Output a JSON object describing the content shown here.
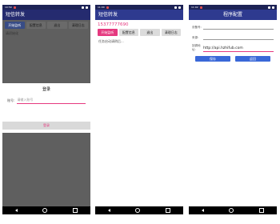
{
  "phone1": {
    "status": {
      "time": "10:59"
    },
    "app_title": "短信转发",
    "buttons": [
      "开始监听",
      "配置信息",
      "退出",
      "清理日志"
    ],
    "label": "请初始化",
    "dialog": {
      "title": "登录",
      "field_label": "账号:",
      "placeholder": "请输入账号",
      "login_label": "登录"
    }
  },
  "phone2": {
    "status": {
      "time": "11:00"
    },
    "app_title": "短信转发",
    "phone_number": "15377777690",
    "buttons": [
      "开始监听",
      "配置信息",
      "退出",
      "清理日志"
    ],
    "message": "任务启动请稍后..."
  },
  "phone3": {
    "status": {
      "time": "11:02"
    },
    "title": "程序配置",
    "fields": [
      {
        "label": "设备号:",
        "value": ""
      },
      {
        "label": "来源:",
        "value": ""
      },
      {
        "label": "回调地址:",
        "value": "http://api.hzhifub.com"
      }
    ],
    "save_label": "保存",
    "back_label": "返回"
  }
}
